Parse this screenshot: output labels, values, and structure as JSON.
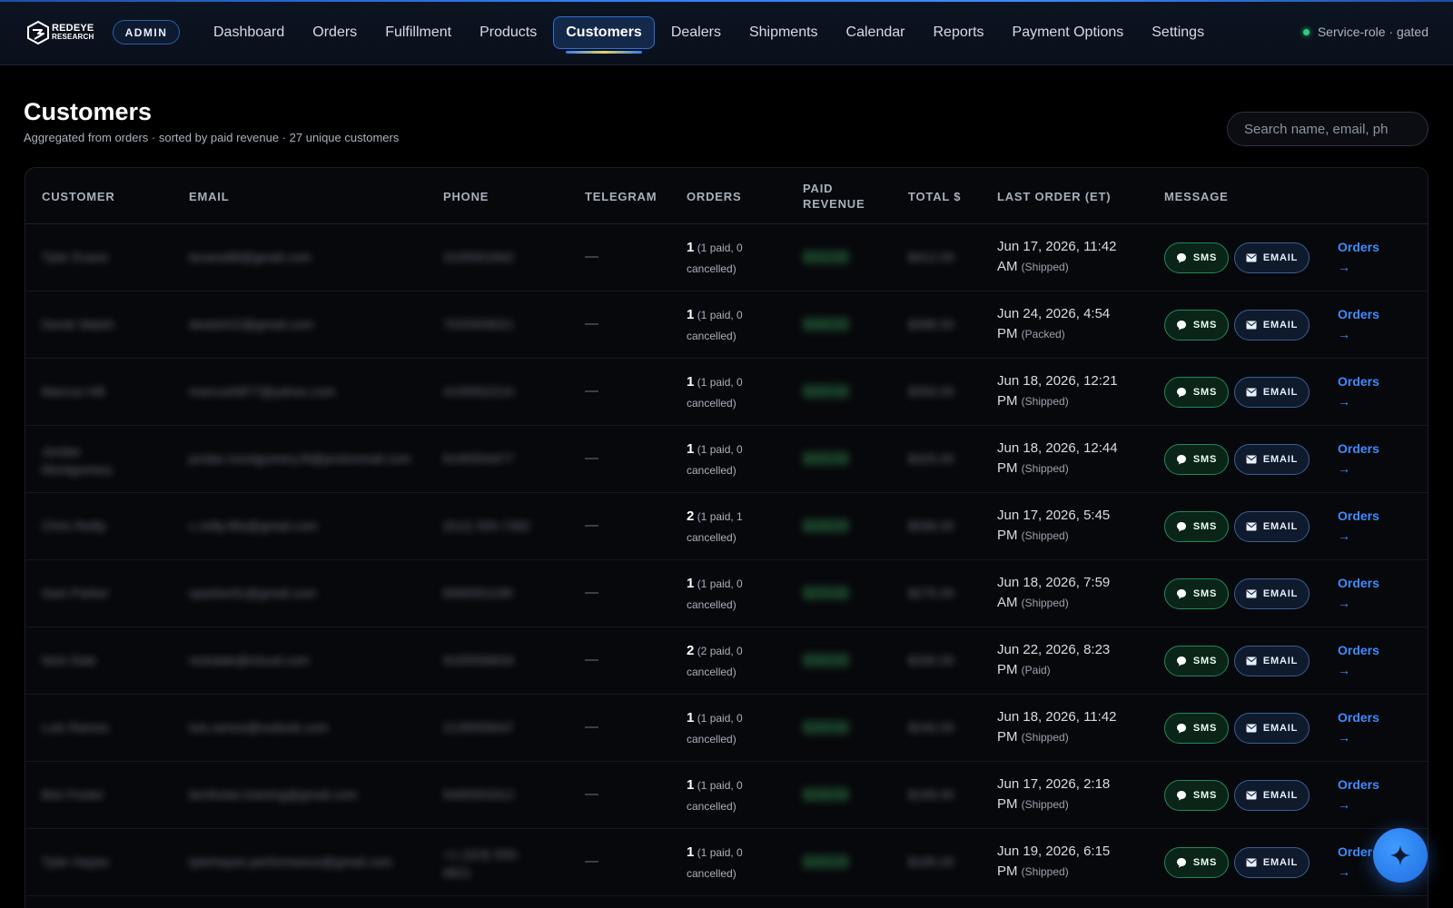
{
  "header": {
    "brand_line1": "REDEYE",
    "brand_line2": "RESEARCH",
    "admin_label": "ADMIN",
    "nav": [
      {
        "label": "Dashboard"
      },
      {
        "label": "Orders"
      },
      {
        "label": "Fulfillment"
      },
      {
        "label": "Products"
      },
      {
        "label": "Customers",
        "active": true
      },
      {
        "label": "Dealers"
      },
      {
        "label": "Shipments"
      },
      {
        "label": "Calendar"
      },
      {
        "label": "Reports"
      },
      {
        "label": "Payment Options"
      },
      {
        "label": "Settings"
      }
    ],
    "status": "Service-role · gated"
  },
  "page": {
    "title": "Customers",
    "subtitle": "Aggregated from orders · sorted by paid revenue · 27 unique customers",
    "search_placeholder": "Search name, email, ph"
  },
  "table": {
    "columns": {
      "customer": "CUSTOMER",
      "email": "EMAIL",
      "phone": "PHONE",
      "telegram": "TELEGRAM",
      "orders": "ORDERS",
      "paid_revenue_1": "PAID",
      "paid_revenue_2": "REVENUE",
      "total": "TOTAL $",
      "last_order": "LAST ORDER (ET)",
      "message": "MESSAGE"
    },
    "sms_label": "SMS",
    "email_label": "EMAIL",
    "orders_link": "Orders",
    "arrow": "→",
    "rows": [
      {
        "name": "Tyler Evans",
        "email": "tevans88@gmail.com",
        "phone": "3105551842",
        "telegram": "—",
        "orders": "1",
        "orders_detail": "(1 paid, 0 cancelled)",
        "paid": "$412.00",
        "total": "$412.00",
        "last_1": "Jun 17, 2026, 11:42",
        "last_2": "AM",
        "status": "(Shipped)"
      },
      {
        "name": "Derek Walsh",
        "email": "dwalsh22@gmail.com",
        "phone": "7025559021",
        "telegram": "—",
        "orders": "1",
        "orders_detail": "(1 paid, 0 cancelled)",
        "paid": "$386.50",
        "total": "$386.50",
        "last_1": "Jun 24, 2026, 4:54",
        "last_2": "PM",
        "status": "(Packed)"
      },
      {
        "name": "Marcus Hill",
        "email": "marcushill77@yahoo.com",
        "phone": "4155552210",
        "telegram": "—",
        "orders": "1",
        "orders_detail": "(1 paid, 0 cancelled)",
        "paid": "$350.00",
        "total": "$350.00",
        "last_1": "Jun 18, 2026, 12:21",
        "last_2": "PM",
        "status": "(Shipped)"
      },
      {
        "name": "Jordan Montgomery",
        "email": "jordan.montgomery.fit@protonmail.com",
        "phone": "6195554477",
        "telegram": "—",
        "orders": "1",
        "orders_detail": "(1 paid, 0 cancelled)",
        "paid": "$325.00",
        "total": "$325.00",
        "last_1": "Jun 18, 2026, 12:44",
        "last_2": "PM",
        "status": "(Shipped)"
      },
      {
        "name": "Chris Reilly",
        "email": "c.reilly.lifts@gmail.com",
        "phone": "(512) 555-7382",
        "telegram": "—",
        "orders": "2",
        "orders_detail": "(1 paid, 1 cancelled)",
        "paid": "$298.00",
        "total": "$596.00",
        "last_1": "Jun 17, 2026, 5:45",
        "last_2": "PM",
        "status": "(Shipped)"
      },
      {
        "name": "Sam Parker",
        "email": "sparker91@gmail.com",
        "phone": "8585551190",
        "telegram": "—",
        "orders": "1",
        "orders_detail": "(1 paid, 0 cancelled)",
        "paid": "$275.00",
        "total": "$275.00",
        "last_1": "Jun 18, 2026, 7:59",
        "last_2": "AM",
        "status": "(Shipped)"
      },
      {
        "name": "Nick Dale",
        "email": "nickdale@icloud.com",
        "phone": "9165556634",
        "telegram": "—",
        "orders": "2",
        "orders_detail": "(2 paid, 0 cancelled)",
        "paid": "$260.00",
        "total": "$260.00",
        "last_1": "Jun 22, 2026, 8:23",
        "last_2": "PM",
        "status": "(Paid)"
      },
      {
        "name": "Luis Ramos",
        "email": "luis.ramos@outlook.com",
        "phone": "2135559047",
        "telegram": "—",
        "orders": "1",
        "orders_detail": "(1 paid, 0 cancelled)",
        "paid": "$240.00",
        "total": "$240.00",
        "last_1": "Jun 18, 2026, 11:42",
        "last_2": "PM",
        "status": "(Shipped)"
      },
      {
        "name": "Ben Foster",
        "email": "benfoster.training@gmail.com",
        "phone": "9495553312",
        "telegram": "—",
        "orders": "1",
        "orders_detail": "(1 paid, 0 cancelled)",
        "paid": "$199.00",
        "total": "$199.00",
        "last_1": "Jun 17, 2026, 2:18",
        "last_2": "PM",
        "status": "(Shipped)"
      },
      {
        "name": "Tyler Hayes",
        "email": "tylerhayes.performance@gmail.com",
        "phone": "+1 (323) 555-8821",
        "telegram": "—",
        "orders": "1",
        "orders_detail": "(1 paid, 0 cancelled)",
        "paid": "$185.00",
        "total": "$185.00",
        "last_1": "Jun 19, 2026, 6:15",
        "last_2": "PM",
        "status": "(Shipped)"
      }
    ]
  },
  "colors": {
    "accent": "#2f7df6",
    "sms_green": "#1f8a5a",
    "link_blue": "#3d8cff",
    "status_dot": "#2ecf7a"
  },
  "icons": {
    "brand": "redeye-logo-icon",
    "sms": "chat-bubble-icon",
    "email": "envelope-icon",
    "fab": "sparkle-icon"
  }
}
